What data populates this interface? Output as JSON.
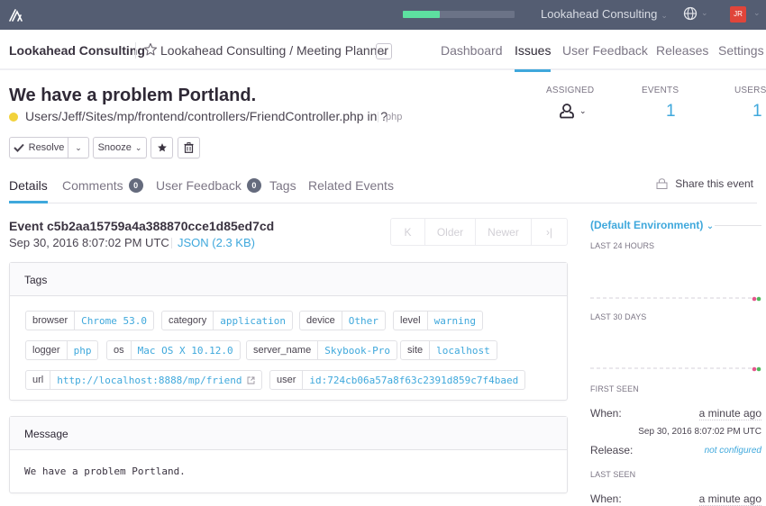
{
  "topbar": {
    "logo_icon": "sentry-logo-icon",
    "progress_fraction": 0.33,
    "org_switcher": "Lookahead Consulting",
    "globe_icon": "globe-icon",
    "avatar_initials": "JR",
    "colors": {
      "bar_bg": "#545d72",
      "progress": "#5de0a0",
      "avatar": "#e0453a"
    }
  },
  "subheader": {
    "org": "Lookahead Consulting",
    "project": "Lookahead Consulting / Meeting Planner",
    "nav": [
      {
        "label": "Dashboard",
        "active": false
      },
      {
        "label": "Issues",
        "active": true
      },
      {
        "label": "User Feedback",
        "active": false
      },
      {
        "label": "Releases",
        "active": false
      },
      {
        "label": "Settings",
        "active": false
      }
    ]
  },
  "issue": {
    "title": "We have a problem Portland.",
    "culprit": "Users/Jeff/Sites/mp/frontend/controllers/FriendController.php in ?",
    "platform": "php",
    "level_color": "#f2d23b",
    "actions": {
      "resolve": "Resolve",
      "snooze": "Snooze"
    },
    "stats": {
      "assigned_label": "ASSIGNED",
      "events_label": "EVENTS",
      "events": "1",
      "users_label": "USERS",
      "users": "1"
    }
  },
  "tabs": [
    {
      "label": "Details",
      "active": true
    },
    {
      "label": "Comments",
      "badge": "0"
    },
    {
      "label": "User Feedback",
      "badge": "0"
    },
    {
      "label": "Tags"
    },
    {
      "label": "Related Events"
    }
  ],
  "share_label": "Share this event",
  "event": {
    "id": "Event c5b2aa15759a4a388870cce1d85ed7cd",
    "date": "Sep 30, 2016 8:07:02 PM UTC",
    "json": "JSON (2.3 KB)",
    "pager": {
      "first": "K",
      "older": "Older",
      "newer": "Newer",
      "last": "›|"
    }
  },
  "tags_box": {
    "title": "Tags",
    "tags": [
      {
        "key": "browser",
        "value": "Chrome 53.0"
      },
      {
        "key": "category",
        "value": "application"
      },
      {
        "key": "device",
        "value": "Other"
      },
      {
        "key": "level",
        "value": "warning"
      },
      {
        "key": "logger",
        "value": "php"
      },
      {
        "key": "os",
        "value": "Mac OS X 10.12.0"
      },
      {
        "key": "server_name",
        "value": "Skybook-Pro"
      },
      {
        "key": "site",
        "value": "localhost"
      },
      {
        "key": "url",
        "value": "http://localhost:8888/mp/friend"
      },
      {
        "key": "user",
        "value": "id:724cb06a57a8f63c2391d859c7f4baed"
      }
    ]
  },
  "message_box": {
    "title": "Message",
    "text": "We have a problem Portland."
  },
  "sidebar": {
    "environment": "(Default Environment)",
    "last_24h_label": "LAST 24 HOURS",
    "last_30d_label": "LAST 30 DAYS",
    "first_seen_label": "FIRST SEEN",
    "first_when_label": "When:",
    "first_when": "a minute ago",
    "first_date": "Sep 30, 2016 8:07:02 PM UTC",
    "release_label": "Release:",
    "release": "not configured",
    "last_seen_label": "LAST SEEN",
    "last_when_label": "When:",
    "last_when": "a minute ago"
  }
}
